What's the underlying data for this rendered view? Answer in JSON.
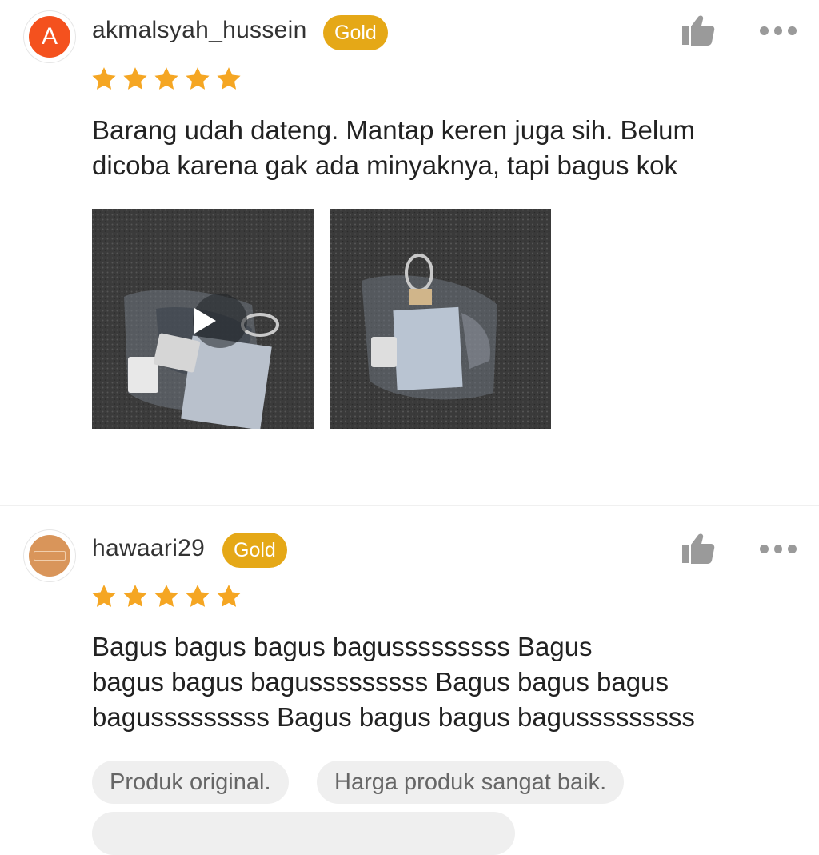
{
  "reviews": [
    {
      "username": "akmalsyah_hussein",
      "avatar_letter": "A",
      "avatar_color": "#f4511e",
      "badge": "Gold",
      "rating": 5,
      "text_lines": [
        "Barang udah dateng. Mantap keren juga sih. Belum",
        "dicoba karena gak ada minyaknya, tapi bagus kok"
      ],
      "media": [
        {
          "type": "video",
          "thumbnail": "keychain photo"
        },
        {
          "type": "image",
          "thumbnail": "keychain photo"
        }
      ]
    },
    {
      "username": "hawaari29",
      "avatar_color": "#d9955a",
      "badge": "Gold",
      "rating": 5,
      "text_lines": [
        "Bagus bagus bagus bagusssssssss Bagus",
        "bagus bagus bagusssssssss Bagus bagus bagus",
        "bagusssssssss Bagus bagus bagus bagusssssssss"
      ],
      "tags": [
        "Produk original.",
        "Harga produk sangat baik."
      ]
    }
  ],
  "icons": {
    "like": "thumbs-up-icon",
    "more": "more-horizontal-icon",
    "star": "star-icon",
    "play": "play-icon"
  },
  "colors": {
    "badge": "#e5a817",
    "star": "#f5a623",
    "tag_bg": "#efefef"
  }
}
